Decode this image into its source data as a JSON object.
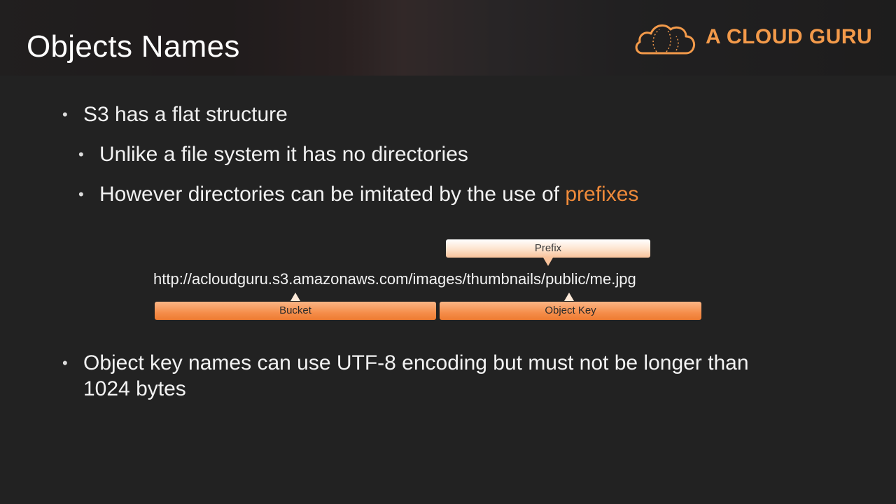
{
  "slide": {
    "title": "Objects Names",
    "logo_text": "A CLOUD GURU",
    "bullets": [
      {
        "text": "S3 has a flat structure"
      },
      {
        "text": "Unlike a file system it has no directories"
      },
      {
        "text_before": "However directories can be imitated by the use of ",
        "highlight": "prefixes"
      },
      {
        "line1": "Object key names can use UTF-8 encoding but must not be longer than",
        "line2": "1024 bytes"
      }
    ],
    "diagram": {
      "url_bucket_part": "http://acloudguru.s3.amazonaws.com",
      "url_key_part": "/images/thumbnails/public/me.jpg",
      "prefix_label": "Prefix",
      "bucket_label": "Bucket",
      "object_key_label": "Object Key"
    }
  },
  "colors": {
    "accent": "#ef8a3a",
    "logo": "#f39a4a",
    "background": "#222222"
  },
  "icons": [
    "cloud-logo-icon"
  ]
}
